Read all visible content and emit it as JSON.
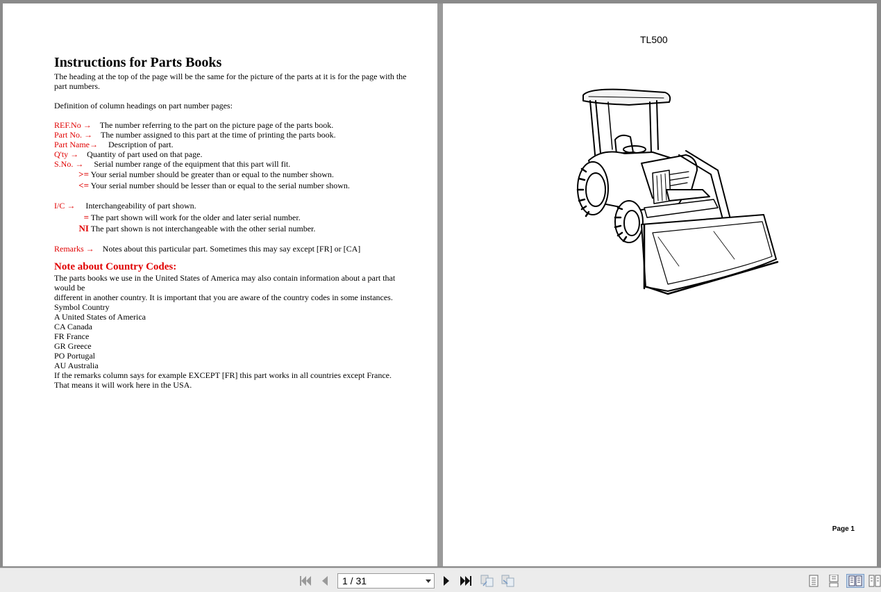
{
  "left_page": {
    "title": "Instructions for Parts Books",
    "intro": "The heading at the top of the page will be the same for the picture of the parts at it is for the page with the part numbers.",
    "definition_heading": "Definition of column headings on part number pages:",
    "columns": [
      {
        "label": "REF.No",
        "desc": "The number referring to the part on the picture page of the parts book."
      },
      {
        "label": "Part No.",
        "desc": "The number assigned to this part at the time of printing the parts book."
      },
      {
        "label": "Part Name",
        "desc": "Description of part."
      },
      {
        "label": "Q'ty",
        "desc": "Quantity of part used on that page."
      },
      {
        "label": "S.No.",
        "desc": "Serial number range of the equipment that this part will fit."
      }
    ],
    "serial_notes": [
      {
        "symbol": ">=",
        "text": "Your serial number should be greater than or equal to the number shown."
      },
      {
        "symbol": "<=",
        "text": "Your serial number should be lesser than or equal to the serial number shown."
      }
    ],
    "ic": {
      "label": "I/C",
      "desc": "Interchangeability of part shown."
    },
    "ic_notes": [
      {
        "symbol": "=",
        "text": "The part shown will work for the older and later serial number."
      },
      {
        "symbol": "NI",
        "text": "The part shown is not interchangeable with the other serial number."
      }
    ],
    "remarks": {
      "label": "Remarks",
      "desc": "Notes about this particular part. Sometimes this may say except [FR] or [CA]"
    },
    "country_heading": "Note about Country Codes:",
    "country_para_1": "The parts books we use in the United States of America may also contain information about a part that would be",
    "country_para_2": "different in another country. It is important that you are aware of the country codes in some instances.",
    "symbol_header": "Symbol Country",
    "countries": [
      "A United States of America",
      "CA Canada",
      "FR France",
      "GR Greece",
      "PO Portugal",
      "AU Australia"
    ],
    "closing_1": "If the remarks column says for example EXCEPT [FR] this part works in all countries except France.",
    "closing_2": "That means it will work here in the USA."
  },
  "right_page": {
    "model": "TL500",
    "page_label": "Page 1"
  },
  "toolbar": {
    "page_indicator": "1 / 31"
  },
  "icons": {
    "arrow": "right-arrow-icon",
    "first": "first-page-icon",
    "prev": "previous-page-icon",
    "next": "next-page-icon",
    "last": "last-page-icon"
  },
  "colors": {
    "accent_red": "#e00000"
  }
}
